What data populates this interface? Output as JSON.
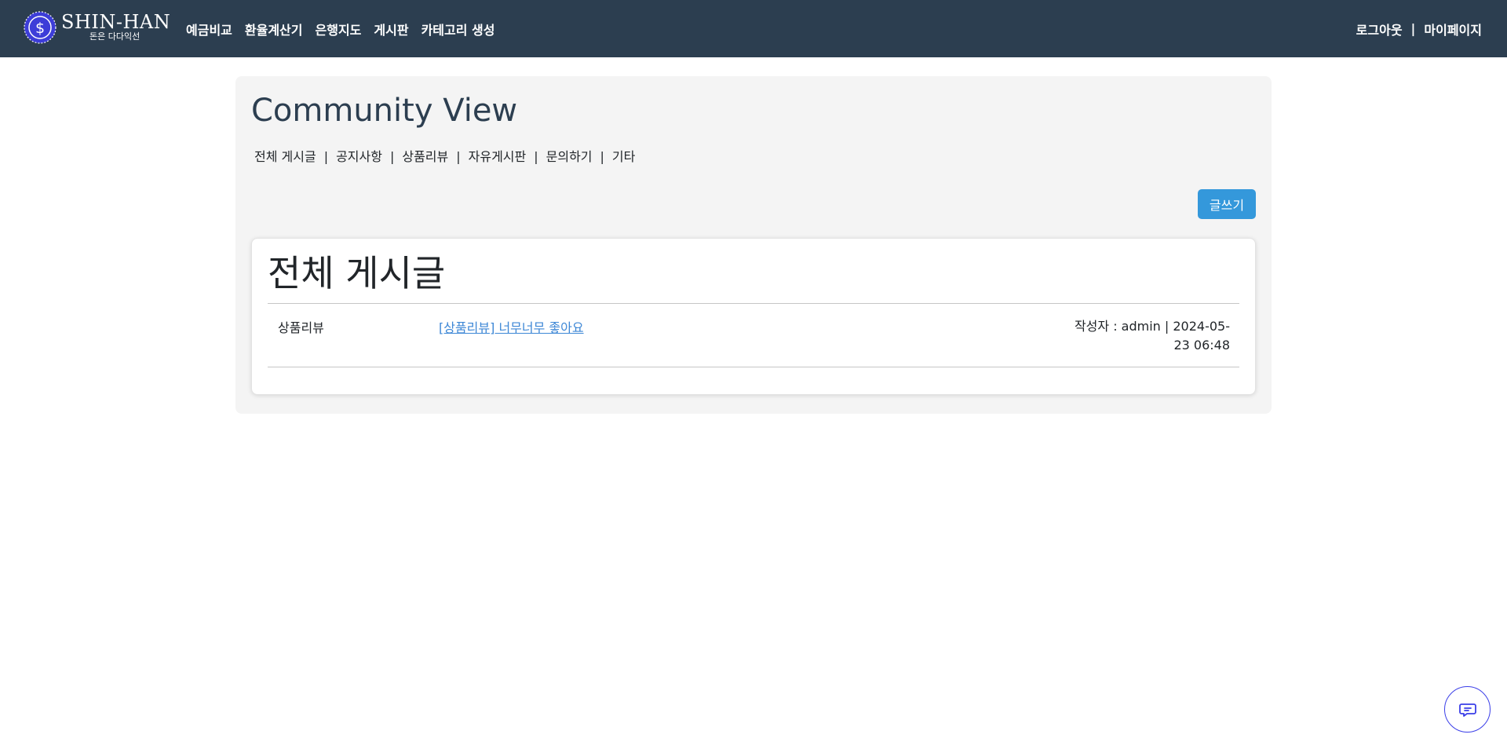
{
  "brand": {
    "title": "SHIN-HAN",
    "subtitle": "돈은 다다익선",
    "emblem_icon": "dollar-coin-icon",
    "emblem_color": "#3d3dd8"
  },
  "nav": {
    "items": [
      {
        "label": "예금비교"
      },
      {
        "label": "환율계산기"
      },
      {
        "label": "은행지도"
      },
      {
        "label": "게시판"
      },
      {
        "label": "카테고리 생성"
      }
    ],
    "logout": "로그아웃",
    "separator": "|",
    "mypage": "마이페이지"
  },
  "page": {
    "title": "Community View",
    "categories": [
      {
        "label": "전체 게시글"
      },
      {
        "label": "공지사항"
      },
      {
        "label": "상품리뷰"
      },
      {
        "label": "자유게시판"
      },
      {
        "label": "문의하기"
      },
      {
        "label": "기타"
      }
    ],
    "category_separator": "|",
    "write_button": "글쓰기"
  },
  "board": {
    "title": "전체 게시글",
    "posts": [
      {
        "category": "상품리뷰",
        "title": "[상품리뷰] 너무너무 좋아요",
        "meta": "작성자 : admin | 2024-05-23 06:48"
      }
    ]
  },
  "chat": {
    "icon": "chat-bubble-icon"
  },
  "colors": {
    "navbar": "#2c3e50",
    "accent": "#3498db",
    "link": "#3d87d6",
    "panel": "#f4f4f4"
  }
}
